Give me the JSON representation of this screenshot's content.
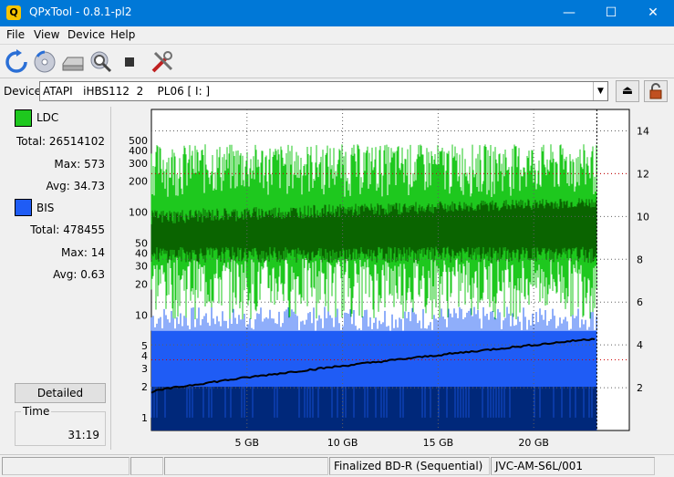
{
  "window": {
    "title": "QPxTool - 0.8.1-pl2",
    "icon_letter": "Q",
    "minimize": "—",
    "maximize": "☐",
    "close": "✕"
  },
  "menu": [
    "File",
    "View",
    "Device",
    "Help"
  ],
  "toolbar_icons": [
    "refresh-icon",
    "disc-icon",
    "drive-icon",
    "scan-icon",
    "stop-icon",
    "tools-icon"
  ],
  "device": {
    "label": "Device:",
    "value": "ATAPI   iHBS112  2    PL06 [ I: ]"
  },
  "ldc": {
    "name": "LDC",
    "color": "#1ec81e",
    "total_label": "Total:",
    "total": "26514102",
    "max_label": "Max:",
    "max": "573",
    "avg_label": "Avg:",
    "avg": "34.73"
  },
  "bis": {
    "name": "BIS",
    "color": "#1f5cf5",
    "total_label": "Total:",
    "total": "478455",
    "max_label": "Max:",
    "max": "14",
    "avg_label": "Avg:",
    "avg": "0.63"
  },
  "buttons": {
    "detailed": "Detailed"
  },
  "time": {
    "label": "Time",
    "value": "31:19"
  },
  "status": {
    "disc_type": "Finalized BD-R (Sequential)",
    "media_id": "JVC-AM-S6L/001"
  },
  "chart_data": {
    "type": "area",
    "x_ticks": [
      "5 GB",
      "10 GB",
      "15 GB",
      "20 GB"
    ],
    "x_tick_values": [
      5,
      10,
      15,
      20
    ],
    "x_range": [
      0,
      25
    ],
    "x_end": 23.3,
    "y_left_scale": "log",
    "y_left_ticks": [
      "1",
      "2",
      "3",
      "4",
      "5",
      "10",
      "20",
      "30",
      "40",
      "50",
      "100",
      "200",
      "300",
      "400",
      "500"
    ],
    "y_left_tick_values": [
      1,
      2,
      3,
      4,
      5,
      10,
      20,
      30,
      40,
      50,
      100,
      200,
      300,
      400,
      500
    ],
    "y_right_ticks": [
      "2",
      "4",
      "6",
      "8",
      "10",
      "12",
      "14"
    ],
    "y_right_tick_values": [
      2,
      4,
      6,
      8,
      10,
      12,
      14
    ],
    "y_right_range": [
      0,
      15
    ],
    "grid": true,
    "series": [
      {
        "name": "LDC",
        "color": "#1ec81e",
        "dark_color": "#0a6400",
        "peak_avg": 200,
        "low_avg": 30,
        "core_high": 100,
        "core_low": 40
      },
      {
        "name": "BIS",
        "color": "#1f5cf5",
        "dark_color": "#00287a",
        "level": 7,
        "dark_level": 2
      },
      {
        "name": "speed",
        "color": "#000000",
        "start": 1.8,
        "end": 4.3
      }
    ]
  }
}
